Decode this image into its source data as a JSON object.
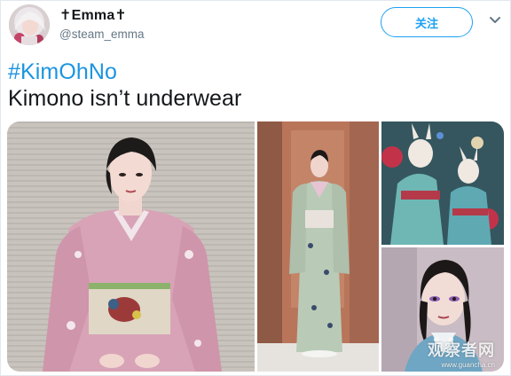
{
  "user": {
    "display_name": "✝Emma✝",
    "handle": "@steam_emma"
  },
  "follow_button": {
    "label": "关注"
  },
  "tweet": {
    "hashtag": "#KimOhNo",
    "text": "Kimono isn’t underwear"
  },
  "media": {
    "photo_count": 4
  },
  "watermark": {
    "name": "观察者网",
    "url": "www.guancha.cn"
  },
  "colors": {
    "accent": "#1da1f2",
    "hashtag": "#1b95e0",
    "text": "#14171a",
    "secondary_text": "#657786"
  }
}
